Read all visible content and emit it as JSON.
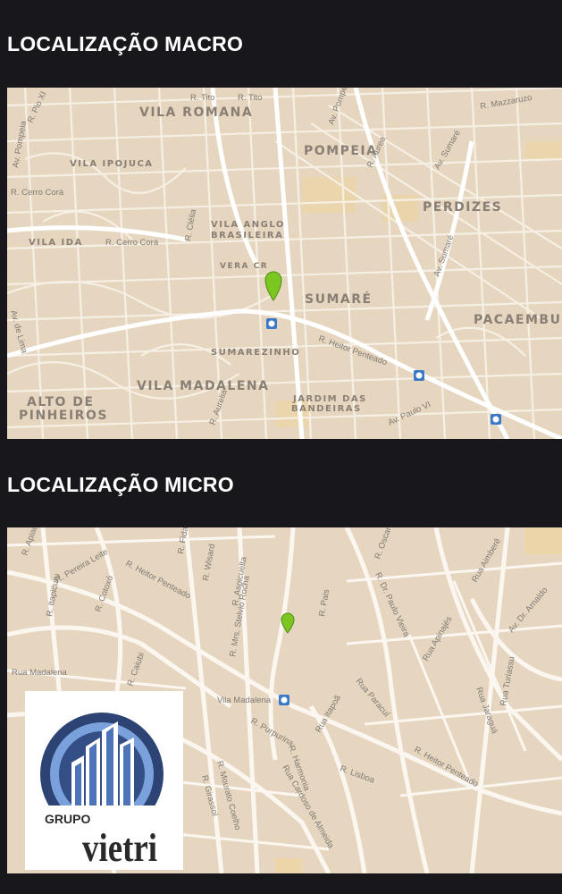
{
  "macro": {
    "title": "LOCALIZAÇÃO MACRO",
    "neighborhoods": [
      "VILA ROMANA",
      "POMPEIA",
      "PERDIZES",
      "SUMARÉ",
      "PACAEMBU",
      "VILA MADALENA",
      "ALTO DE",
      "PINHEIROS",
      "VILA IPOJUCA",
      "VILA IDA",
      "VILA ANGLO",
      "BRASILEIRA",
      "SUMAREZINHO",
      "JARDIM DAS",
      "BANDEIRAS",
      "VERA CR"
    ],
    "streets": [
      "R. Tito",
      "R. Tito",
      "R. Pio XI",
      "R. Heitor Penteado",
      "R. Cerro Corá",
      "R. Cerro Corá",
      "Av. Pompeia",
      "R. Clélia",
      "Av. Sumaré",
      "Av. Sumaré",
      "R. Aurea",
      "Av. Paulo VI",
      "R. Mazzaruzo",
      "Av. Pompeia",
      "R. Aurelia",
      "Av. de Lima"
    ]
  },
  "micro": {
    "title": "LOCALIZAÇÃO MICRO",
    "station": "Vila Madalena",
    "streets": [
      "R. Pereira Leite",
      "R. Heitor Penteado",
      "R. Heitor Penteado",
      "R. Girassol",
      "R. Fidalga",
      "R. Aspicuelta",
      "R. Wisard",
      "R. Harmonia",
      "R. Purpurina",
      "R. Mourato Coelho",
      "Rua Paracuí",
      "Rua Apinajés",
      "Rua Aimberê",
      "Rua Cardoso de Almeida",
      "Rua Jaraguá",
      "Rua Turiassu",
      "R. Dr. Paulo Vieira",
      "R. Caiubi",
      "Av. Dr. Arnaldo",
      "R. Pais",
      "R. Oscar Freire",
      "R. Mrs. Stelvio Rocha",
      "R. Lisboa",
      "R. Cotoxó",
      "R. Itapicuru",
      "R. Apiacás",
      "Rua Itapoã",
      "Rua Madalena"
    ]
  },
  "logo": {
    "line1": "GRUPO",
    "line2": "vietri"
  }
}
